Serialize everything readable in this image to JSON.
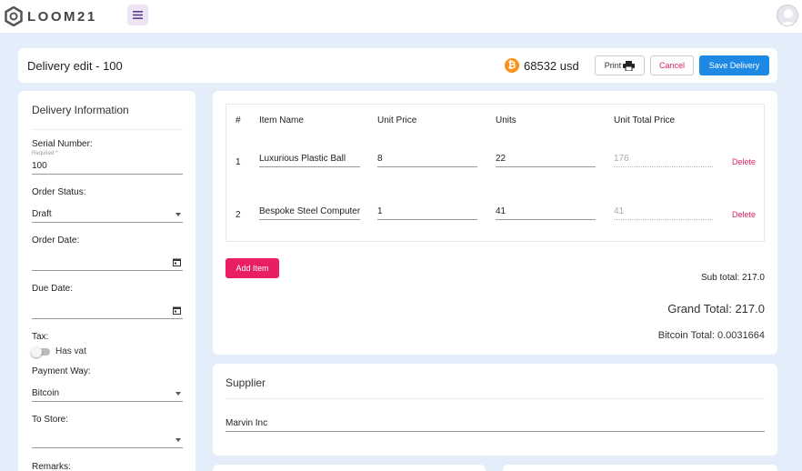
{
  "app": {
    "brand": "LOOM21"
  },
  "header": {
    "title": "Delivery edit - 100",
    "bitcoin_price": "68532 usd",
    "print_label": "Print",
    "cancel_label": "Cancel",
    "save_label": "Save Delivery"
  },
  "delivery_info": {
    "section_title": "Delivery Information",
    "serial_number": {
      "label": "Serial Number:",
      "hint": "Required *",
      "value": "100"
    },
    "order_status": {
      "label": "Order Status:",
      "value": "Draft"
    },
    "order_date": {
      "label": "Order Date:",
      "value": ""
    },
    "due_date": {
      "label": "Due Date:",
      "value": ""
    },
    "tax": {
      "label": "Tax:",
      "toggle_label": "Has vat",
      "checked": false
    },
    "payment_way": {
      "label": "Payment Way:",
      "value": "Bitcoin"
    },
    "to_store": {
      "label": "To Store:",
      "value": ""
    },
    "remarks": {
      "label": "Remarks:"
    }
  },
  "items_table": {
    "columns": [
      "#",
      "Item Name",
      "Unit Price",
      "Units",
      "Unit Total Price"
    ],
    "rows": [
      {
        "index": "1",
        "name": "Luxurious Plastic Ball",
        "unit_price": "8",
        "units": "22",
        "total": "176",
        "action": "Delete"
      },
      {
        "index": "2",
        "name": "Bespoke Steel Computer",
        "unit_price": "1",
        "units": "41",
        "total": "41",
        "action": "Delete"
      }
    ],
    "add_item_label": "Add Item",
    "sub_total": "Sub total: 217.0",
    "grand_total": "Grand Total: 217.0",
    "bitcoin_total": "Bitcoin Total: 0.0031664"
  },
  "supplier": {
    "title": "Supplier",
    "value": "Marvin Inc"
  }
}
